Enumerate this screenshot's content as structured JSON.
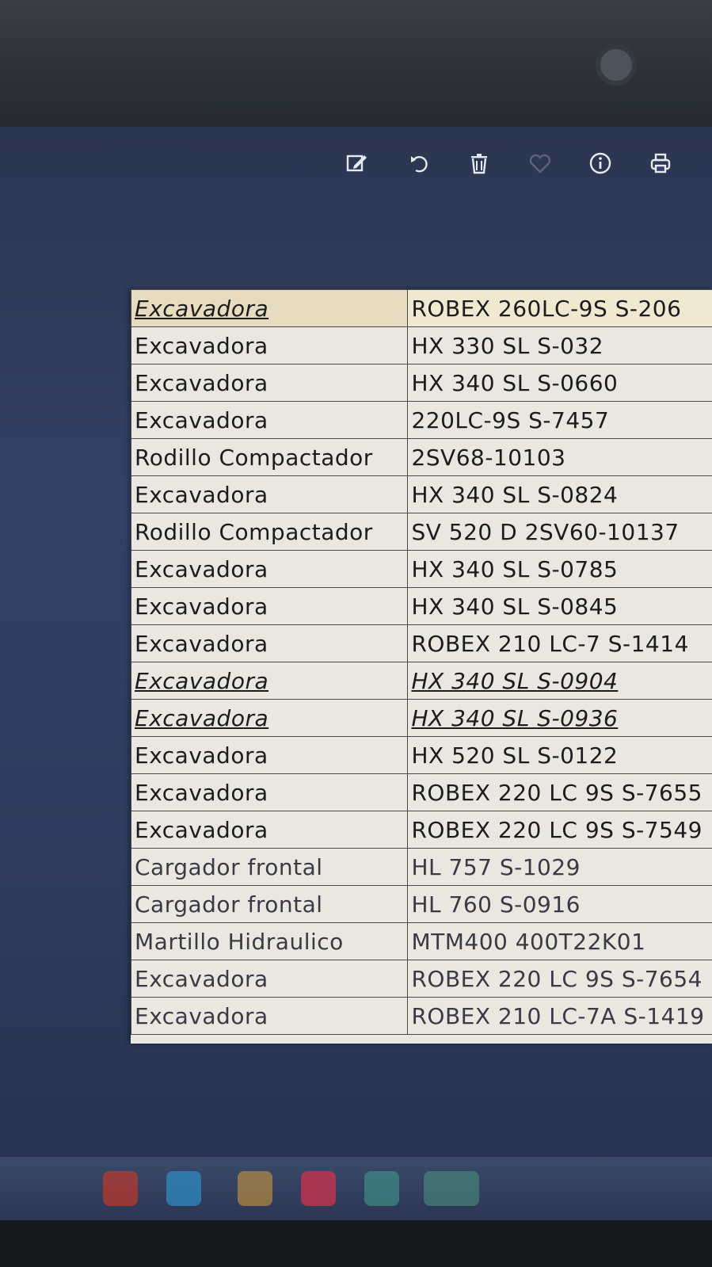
{
  "toolbar": {
    "icons": [
      "edit-icon",
      "rotate-icon",
      "delete-icon",
      "favorite-icon",
      "info-icon",
      "print-icon"
    ]
  },
  "table": {
    "rows": [
      {
        "type": "Excavadora",
        "model": "ROBEX 260LC-9S  S-206"
      },
      {
        "type": "Excavadora",
        "model": "HX 330 SL  S-032"
      },
      {
        "type": "Excavadora",
        "model": "HX 340 SL S-0660"
      },
      {
        "type": "Excavadora",
        "model": "220LC-9S S-7457"
      },
      {
        "type": "Rodillo Compactador",
        "model": "2SV68-10103"
      },
      {
        "type": "Excavadora",
        "model": "HX 340 SL S-0824"
      },
      {
        "type": "Rodillo Compactador",
        "model": "SV 520 D  2SV60-10137"
      },
      {
        "type": "Excavadora",
        "model": "HX 340 SL S-0785"
      },
      {
        "type": "Excavadora",
        "model": "HX 340 SL S-0845"
      },
      {
        "type": "Excavadora",
        "model": "ROBEX 210 LC-7 S-1414"
      },
      {
        "type": "Excavadora",
        "model": "HX 340 SL S-0904"
      },
      {
        "type": "Excavadora",
        "model": "HX 340 SL S-0936"
      },
      {
        "type": "Excavadora",
        "model": "HX 520 SL  S-0122"
      },
      {
        "type": "Excavadora",
        "model": "ROBEX 220 LC 9S S-7655"
      },
      {
        "type": "Excavadora",
        "model": "ROBEX 220 LC 9S S-7549"
      },
      {
        "type": "Cargador frontal",
        "model": "HL 757 S-1029"
      },
      {
        "type": "Cargador frontal",
        "model": "HL 760 S-0916"
      },
      {
        "type": "Martillo Hidraulico",
        "model": "MTM400 400T22K01"
      },
      {
        "type": "Excavadora",
        "model": "ROBEX 220 LC 9S S-7654"
      },
      {
        "type": "Excavadora",
        "model": "ROBEX 210 LC-7A S-1419"
      }
    ]
  },
  "colors": {
    "screen_bg": "#334168",
    "sheet_bg": "#e9e7df",
    "header_row_bg": "#e8dcc0"
  }
}
